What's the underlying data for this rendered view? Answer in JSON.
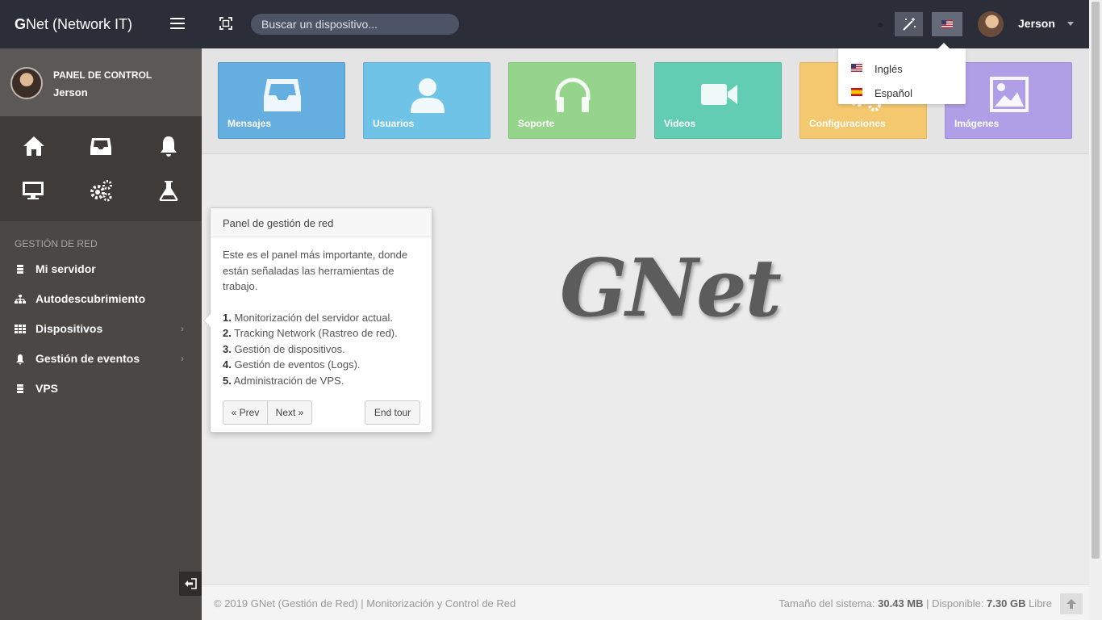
{
  "app": {
    "brand_bold": "G",
    "brand_rest": "Net (Network IT)",
    "logo_text": "GNet"
  },
  "profile": {
    "title": "PANEL DE CONTROL",
    "name": "Jerson"
  },
  "shortcuts": [
    "home-icon",
    "inbox-icon",
    "bell-icon",
    "desktop-icon",
    "gears-icon",
    "flask-icon"
  ],
  "sidebar": {
    "section_title": "GESTIÓN DE RED",
    "items": [
      {
        "label": "Mi servidor",
        "icon": "server-icon",
        "has_submenu": false
      },
      {
        "label": "Autodescubrimiento",
        "icon": "sitemap-icon",
        "has_submenu": false
      },
      {
        "label": "Dispositivos",
        "icon": "grid-icon",
        "has_submenu": true
      },
      {
        "label": "Gestión de eventos",
        "icon": "bell-icon",
        "has_submenu": true
      },
      {
        "label": "VPS",
        "icon": "server-icon",
        "has_submenu": false
      }
    ]
  },
  "topbar": {
    "search_placeholder": "Buscar un dispositivo...",
    "user_name": "Jerson"
  },
  "tiles": [
    {
      "label": "Mensajes",
      "icon": "inbox-icon",
      "color": "#65aee0"
    },
    {
      "label": "Usuarios",
      "icon": "user-icon",
      "color": "#6ec3e6"
    },
    {
      "label": "Soporte",
      "icon": "headphones-icon",
      "color": "#95d58b"
    },
    {
      "label": "Videos",
      "icon": "video-camera-icon",
      "color": "#62cdb2"
    },
    {
      "label": "Configuraciones",
      "icon": "cogs-icon",
      "color": "#f4c86e"
    },
    {
      "label": "Imágenes",
      "icon": "image-icon",
      "color": "#b09ee6"
    }
  ],
  "lang_menu": {
    "items": [
      {
        "label": "Inglés",
        "flag": "us-flag-icon"
      },
      {
        "label": "Español",
        "flag": "es-flag-icon"
      }
    ]
  },
  "tour": {
    "title": "Panel de gestión de red",
    "intro": "Este es el panel más importante, donde están señaladas las herramientas de trabajo.",
    "steps": [
      {
        "num": "1.",
        "text": " Monitorización del servidor actual."
      },
      {
        "num": "2.",
        "text": " Tracking Network (Rastreo de red)."
      },
      {
        "num": "3.",
        "text": " Gestión de dispositivos."
      },
      {
        "num": "4.",
        "text": " Gestión de eventos (Logs)."
      },
      {
        "num": "5.",
        "text": " Administración de VPS."
      }
    ],
    "prev_label": "« Prev",
    "next_label": "Next »",
    "end_label": "End tour"
  },
  "footer": {
    "left": "© 2019 GNet (Gestión de Red) | Monitorización y Control de Red",
    "size_label": "Tamaño del sistema: ",
    "size_value": "30.43 MB",
    "sep": " | Disponible: ",
    "free_value": "7.30 GB",
    "free_suffix": " Libre"
  }
}
